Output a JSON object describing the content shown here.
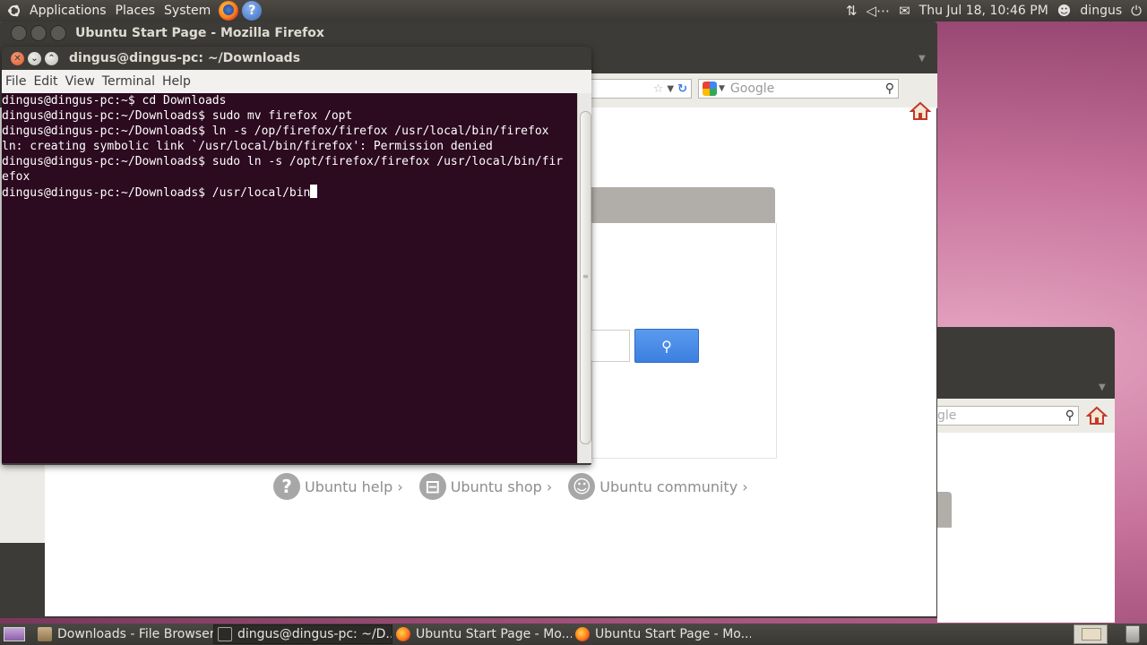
{
  "top_panel": {
    "menus": [
      "Applications",
      "Places",
      "System"
    ],
    "datetime": "Thu Jul 18, 10:46 PM",
    "user": "dingus"
  },
  "firefox": {
    "title": "Ubuntu Start Page - Mozilla Firefox",
    "search_placeholder": "Google",
    "links": [
      "Ubuntu help ›",
      "Ubuntu shop ›",
      "Ubuntu community ›"
    ]
  },
  "firefox2": {
    "search_partial": "gle"
  },
  "terminal": {
    "title": "dingus@dingus-pc: ~/Downloads",
    "menu": [
      "File",
      "Edit",
      "View",
      "Terminal",
      "Help"
    ],
    "lines": [
      "dingus@dingus-pc:~$ cd Downloads",
      "dingus@dingus-pc:~/Downloads$ sudo mv firefox /opt",
      "dingus@dingus-pc:~/Downloads$ ln -s /op/firefox/firefox /usr/local/bin/firefox",
      "ln: creating symbolic link `/usr/local/bin/firefox': Permission denied",
      "dingus@dingus-pc:~/Downloads$ sudo ln -s /opt/firefox/firefox /usr/local/bin/fir",
      "efox"
    ],
    "prompt_line": "dingus@dingus-pc:~/Downloads$ /usr/local/bin"
  },
  "taskbar": {
    "tasks": [
      "Downloads - File Browser",
      "dingus@dingus-pc: ~/D...",
      "Ubuntu Start Page - Mo...",
      "Ubuntu Start Page - Mo..."
    ]
  }
}
